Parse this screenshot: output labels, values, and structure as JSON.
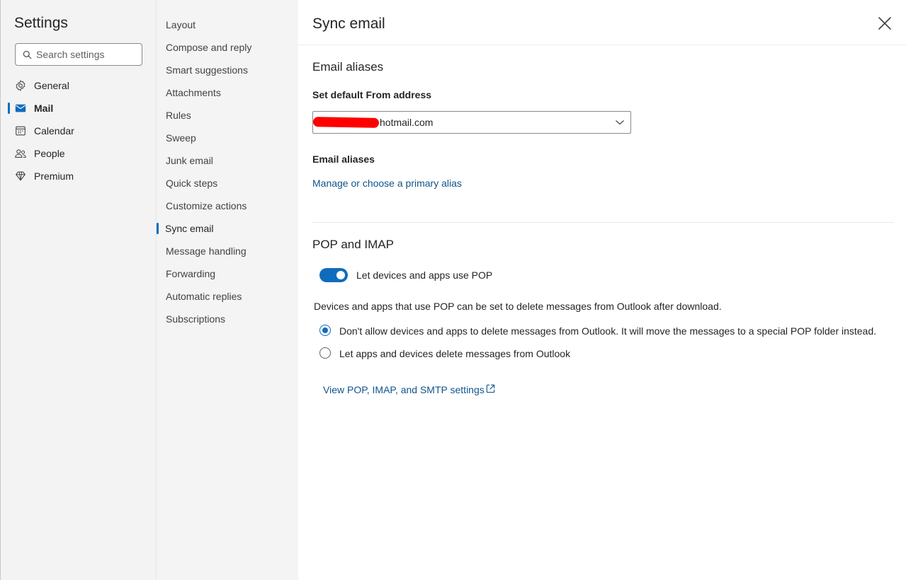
{
  "sidebar": {
    "title": "Settings",
    "search_placeholder": "Search settings",
    "categories": [
      {
        "label": "General",
        "icon": "gear-icon"
      },
      {
        "label": "Mail",
        "icon": "mail-icon"
      },
      {
        "label": "Calendar",
        "icon": "calendar-icon"
      },
      {
        "label": "People",
        "icon": "people-icon"
      },
      {
        "label": "Premium",
        "icon": "diamond-icon"
      }
    ],
    "active_category": "Mail"
  },
  "submenu": {
    "items": [
      "Layout",
      "Compose and reply",
      "Smart suggestions",
      "Attachments",
      "Rules",
      "Sweep",
      "Junk email",
      "Quick steps",
      "Customize actions",
      "Sync email",
      "Message handling",
      "Forwarding",
      "Automatic replies",
      "Subscriptions"
    ],
    "active_item": "Sync email"
  },
  "main": {
    "title": "Sync email",
    "close_icon": "close-icon",
    "email_aliases": {
      "section_title": "Email aliases",
      "from_label": "Set default From address",
      "from_value_suffix": "hotmail.com",
      "aliases_label": "Email aliases",
      "manage_link": "Manage or choose a primary alias"
    },
    "pop_imap": {
      "section_title": "POP and IMAP",
      "toggle_label": "Let devices and apps use POP",
      "toggle_on": true,
      "description": "Devices and apps that use POP can be set to delete messages from Outlook after download.",
      "options": [
        {
          "label": "Don't allow devices and apps to delete messages from Outlook. It will move the messages to a special POP folder instead.",
          "checked": true
        },
        {
          "label": "Let apps and devices delete messages from Outlook",
          "checked": false
        }
      ],
      "settings_link": "View POP, IMAP, and SMTP settings",
      "settings_link_icon": "external-link-icon"
    }
  },
  "colors": {
    "accent": "#0f6cbd",
    "link": "#0f548c",
    "redaction": "#ff0000"
  }
}
